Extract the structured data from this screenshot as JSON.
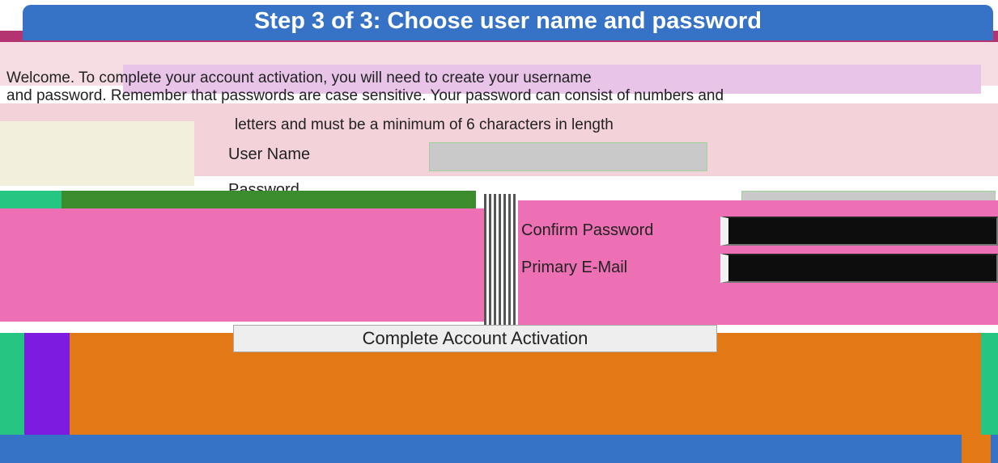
{
  "header": {
    "title": "Step 3 of 3: Choose user name and password"
  },
  "intro": {
    "line1": "Welcome. To complete your account activation, you will need to create your username",
    "line2": "and password. Remember that passwords are case sensitive. Your password can consist of numbers and",
    "line3": "letters and must be a minimum of 6 characters in length"
  },
  "form": {
    "username_label": "User Name",
    "username_value": "",
    "password_label": "Password",
    "password_value": "",
    "confirm_label": "Confirm Password",
    "confirm_value": "",
    "email_label": "Primary E-Mail",
    "email_value": ""
  },
  "actions": {
    "complete_label": "Complete Account Activation"
  }
}
